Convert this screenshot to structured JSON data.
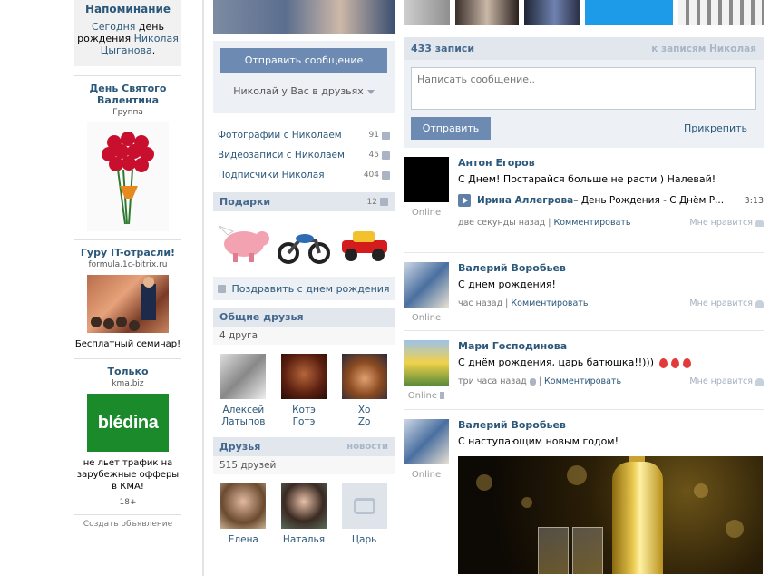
{
  "ads": {
    "reminder": {
      "title": "Напоминание",
      "today": "Сегодня",
      "day_of": "день рождения",
      "name": "Николая Цыганова",
      "dot": "."
    },
    "ad1": {
      "title": "День Святого Валентина",
      "sub": "Группа"
    },
    "ad2": {
      "title": "Гуру IT-отрасли!",
      "sub": "formula.1c-bitrix.ru",
      "desc": "Бесплатный семинар!"
    },
    "ad3": {
      "title": "Только",
      "sub": "kma.biz",
      "logo": "blédina",
      "desc": "не льет трафик на зарубежные офферы в КМА!",
      "age": "18+"
    },
    "create": "Создать объявление"
  },
  "mid": {
    "send_message": "Отправить сообщение",
    "friends_status": "Николай у Вас в друзьях",
    "counters": [
      {
        "label": "Фотографии с Николаем",
        "num": "91",
        "icon": "camera-icon"
      },
      {
        "label": "Видеозаписи с Николаем",
        "num": "45",
        "icon": "film-icon"
      },
      {
        "label": "Подписчики Николая",
        "num": "404",
        "icon": "users-icon"
      }
    ],
    "gifts": {
      "title": "Подарки",
      "count": "12"
    },
    "congratulate": "Поздравить с днем рождения",
    "common": {
      "title": "Общие друзья",
      "count": "4 друга",
      "people": [
        {
          "first": "Алексей",
          "last": "Латыпов"
        },
        {
          "first": "Котэ",
          "last": "Готэ"
        },
        {
          "first": "Хо",
          "last": "Zo"
        }
      ]
    },
    "friends": {
      "title": "Друзья",
      "news": "новости",
      "count": "515 друзей",
      "people": [
        {
          "first": "Елена",
          "last": ""
        },
        {
          "first": "Наталья",
          "last": ""
        },
        {
          "first": "Царь",
          "last": ""
        }
      ]
    }
  },
  "wall": {
    "count": "433 записи",
    "to_posts": "к записям Николая",
    "placeholder": "Написать сообщение..",
    "send": "Отправить",
    "attach": "Прикрепить",
    "online": "Online",
    "comment": "Комментировать",
    "like": "Мне нравится",
    "posts": [
      {
        "author": "Антон Егоров",
        "text": "С Днем! Постарайся больше не расти ) Налевай!",
        "audio_artist": "Ирина Аллегрова",
        "audio_title": " – День Рождения - С Днём Р...",
        "audio_duration": "3:13",
        "time": "две секунды назад"
      },
      {
        "author": "Валерий Воробьев",
        "text": "С днем рождения!",
        "time": "час назад"
      },
      {
        "author": "Мари Господинова",
        "text": "С днём рождения, царь батюшка!!)))",
        "time": "три часа назад"
      },
      {
        "author": "Валерий Воробьев",
        "text": "С наступающим новым годом!"
      }
    ]
  },
  "colors": {
    "accent": "#6d8bb2",
    "link": "#2b587a",
    "header_bg": "#e1e7ed"
  }
}
